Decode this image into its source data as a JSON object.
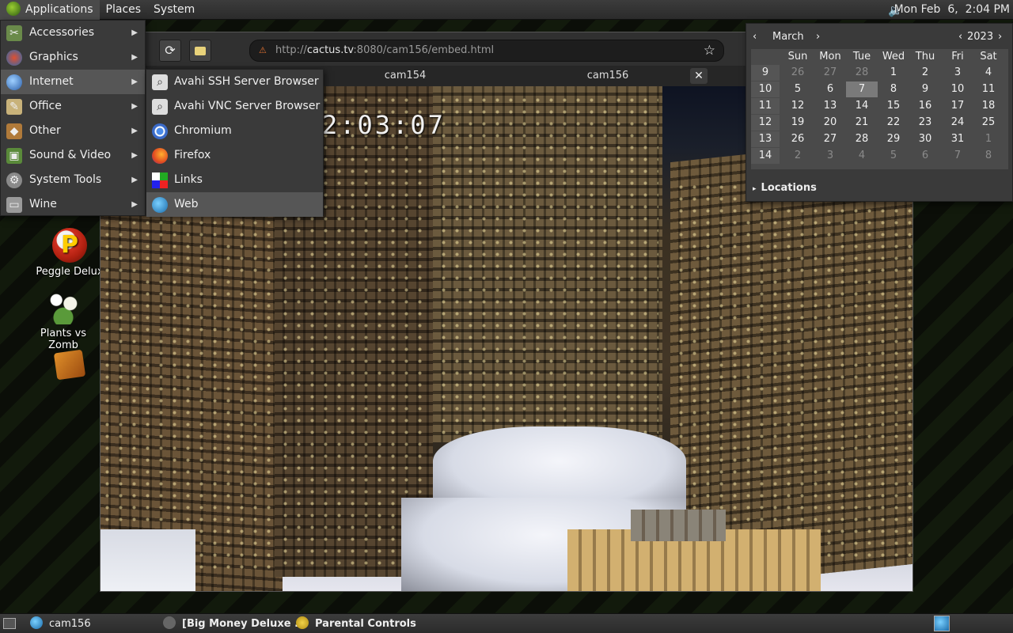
{
  "top_panel": {
    "menus": [
      "Applications",
      "Places",
      "System"
    ],
    "clock": "Mon Feb  6,  2:04 PM"
  },
  "apps_menu": {
    "items": [
      {
        "label": "Accessories",
        "icon": "accessories-icon"
      },
      {
        "label": "Graphics",
        "icon": "graphics-icon"
      },
      {
        "label": "Internet",
        "icon": "internet-icon"
      },
      {
        "label": "Office",
        "icon": "office-icon"
      },
      {
        "label": "Other",
        "icon": "other-icon"
      },
      {
        "label": "Sound & Video",
        "icon": "sound-video-icon"
      },
      {
        "label": "System Tools",
        "icon": "system-tools-icon"
      },
      {
        "label": "Wine",
        "icon": "wine-icon"
      }
    ],
    "highlighted": "Internet"
  },
  "internet_submenu": {
    "items": [
      {
        "label": "Avahi SSH Server Browser",
        "icon": "avahi-icon"
      },
      {
        "label": "Avahi VNC Server Browser",
        "icon": "avahi-icon"
      },
      {
        "label": "Chromium",
        "icon": "chromium-icon"
      },
      {
        "label": "Firefox",
        "icon": "firefox-icon"
      },
      {
        "label": "Links",
        "icon": "links-icon"
      },
      {
        "label": "Web",
        "icon": "web-icon"
      }
    ],
    "highlighted": "Web"
  },
  "browser": {
    "url_prefix": "http://",
    "url_host": "cactus.tv",
    "url_rest": ":8080/cam156/embed.html",
    "tabs": [
      "cam154",
      "cam156"
    ],
    "timestamp": "2:03:07"
  },
  "calendar": {
    "month": "March",
    "year": "2023",
    "weekdays": [
      "Sun",
      "Mon",
      "Tue",
      "Wed",
      "Thu",
      "Fri",
      "Sat"
    ],
    "weeks": [
      {
        "num": "9",
        "days": [
          "26",
          "27",
          "28",
          "1",
          "2",
          "3",
          "4"
        ]
      },
      {
        "num": "10",
        "days": [
          "5",
          "6",
          "7",
          "8",
          "9",
          "10",
          "11"
        ]
      },
      {
        "num": "11",
        "days": [
          "12",
          "13",
          "14",
          "15",
          "16",
          "17",
          "18"
        ]
      },
      {
        "num": "12",
        "days": [
          "19",
          "20",
          "21",
          "22",
          "23",
          "24",
          "25"
        ]
      },
      {
        "num": "13",
        "days": [
          "26",
          "27",
          "28",
          "29",
          "30",
          "31",
          "1"
        ]
      },
      {
        "num": "14",
        "days": [
          "2",
          "3",
          "4",
          "5",
          "6",
          "7",
          "8"
        ]
      }
    ],
    "selected": "7",
    "locations_label": "Locations"
  },
  "desktop_icons": [
    {
      "label": "Peggle Delux"
    },
    {
      "label": "Plants vs Zomb"
    },
    {
      "label": ""
    }
  ],
  "taskbar": {
    "items": [
      "cam156",
      "[Big Money Deluxe ...",
      "Parental Controls"
    ]
  },
  "colors": {
    "panel": "#333333",
    "menu_bg": "#3a3a3a",
    "highlight": "#565656",
    "accent_green": "#9acd32"
  }
}
